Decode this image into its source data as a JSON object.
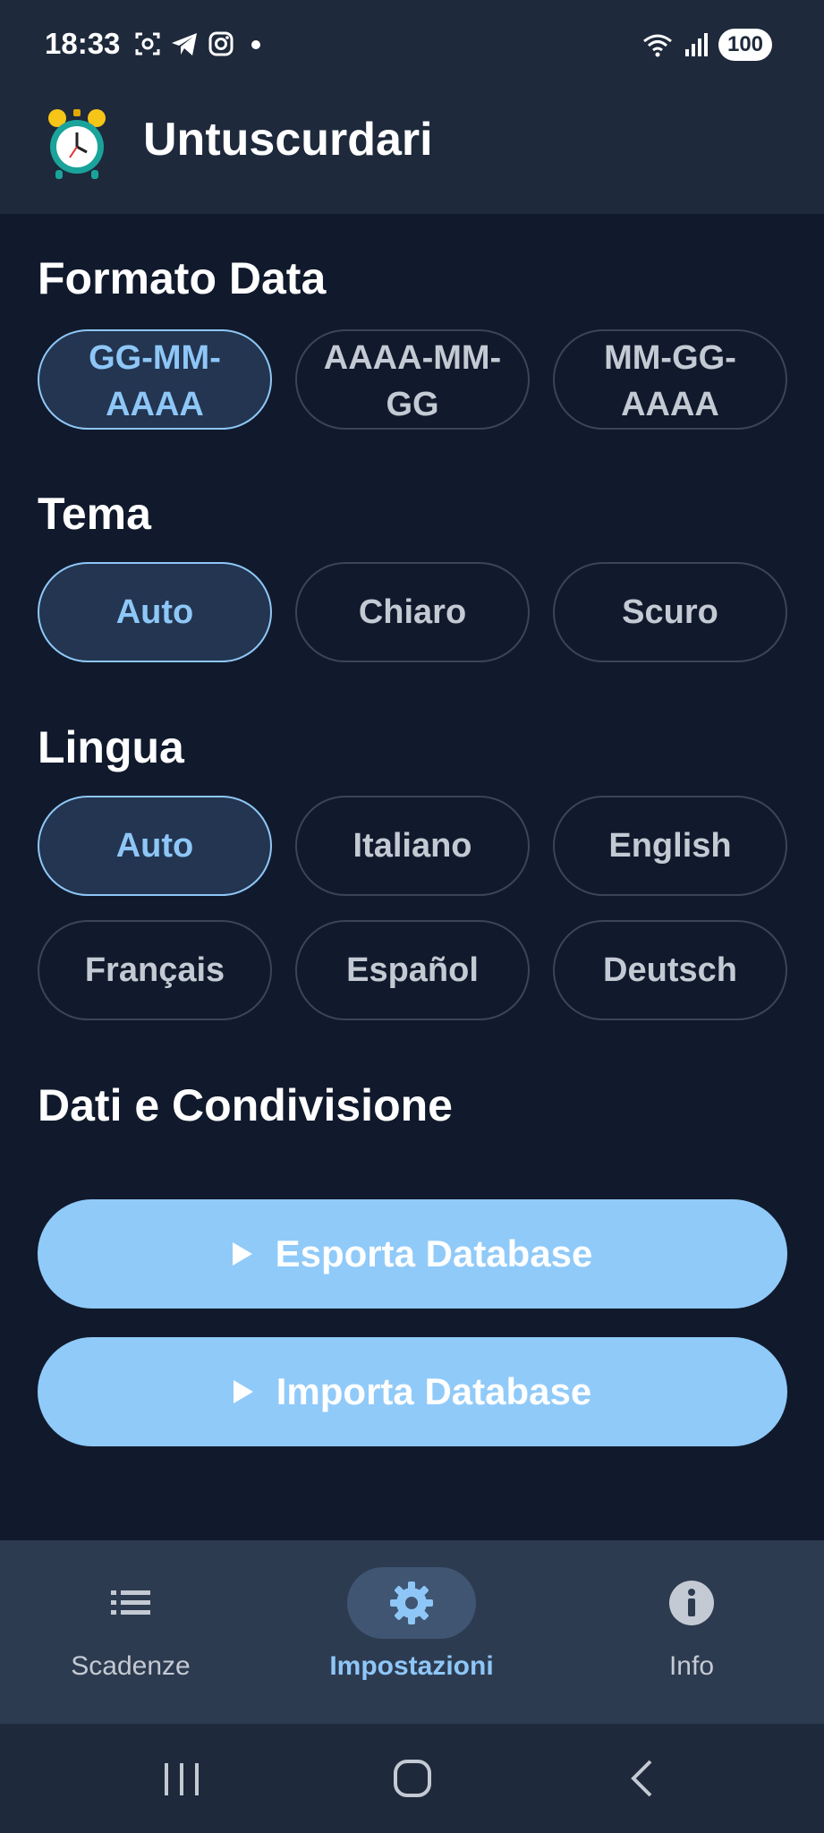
{
  "status_bar": {
    "time": "18:33",
    "battery": "100"
  },
  "app_bar": {
    "title": "Untuscurdari",
    "icon": "alarm-clock-icon"
  },
  "date_format": {
    "title": "Formato Data",
    "options": [
      "GG-MM-AAAA",
      "AAAA-MM-GG",
      "MM-GG-AAAA"
    ],
    "selected": "GG-MM-AAAA"
  },
  "theme": {
    "title": "Tema",
    "options": [
      "Auto",
      "Chiaro",
      "Scuro"
    ],
    "selected": "Auto"
  },
  "language": {
    "title": "Lingua",
    "options": [
      "Auto",
      "Italiano",
      "English",
      "Français",
      "Español",
      "Deutsch"
    ],
    "selected": "Auto"
  },
  "data_sharing": {
    "title": "Dati e Condivisione",
    "export_label": "Esporta Database",
    "import_label": "Importa Database"
  },
  "bottom_nav": {
    "items": [
      {
        "label": "Scadenze",
        "icon": "list-icon"
      },
      {
        "label": "Impostazioni",
        "icon": "gear-icon"
      },
      {
        "label": "Info",
        "icon": "info-icon"
      }
    ],
    "active": "Impostazioni"
  },
  "colors": {
    "background": "#111a2c",
    "bar": "#1e293b",
    "accent": "#90caf9",
    "selected_chip_bg": "#233550"
  }
}
